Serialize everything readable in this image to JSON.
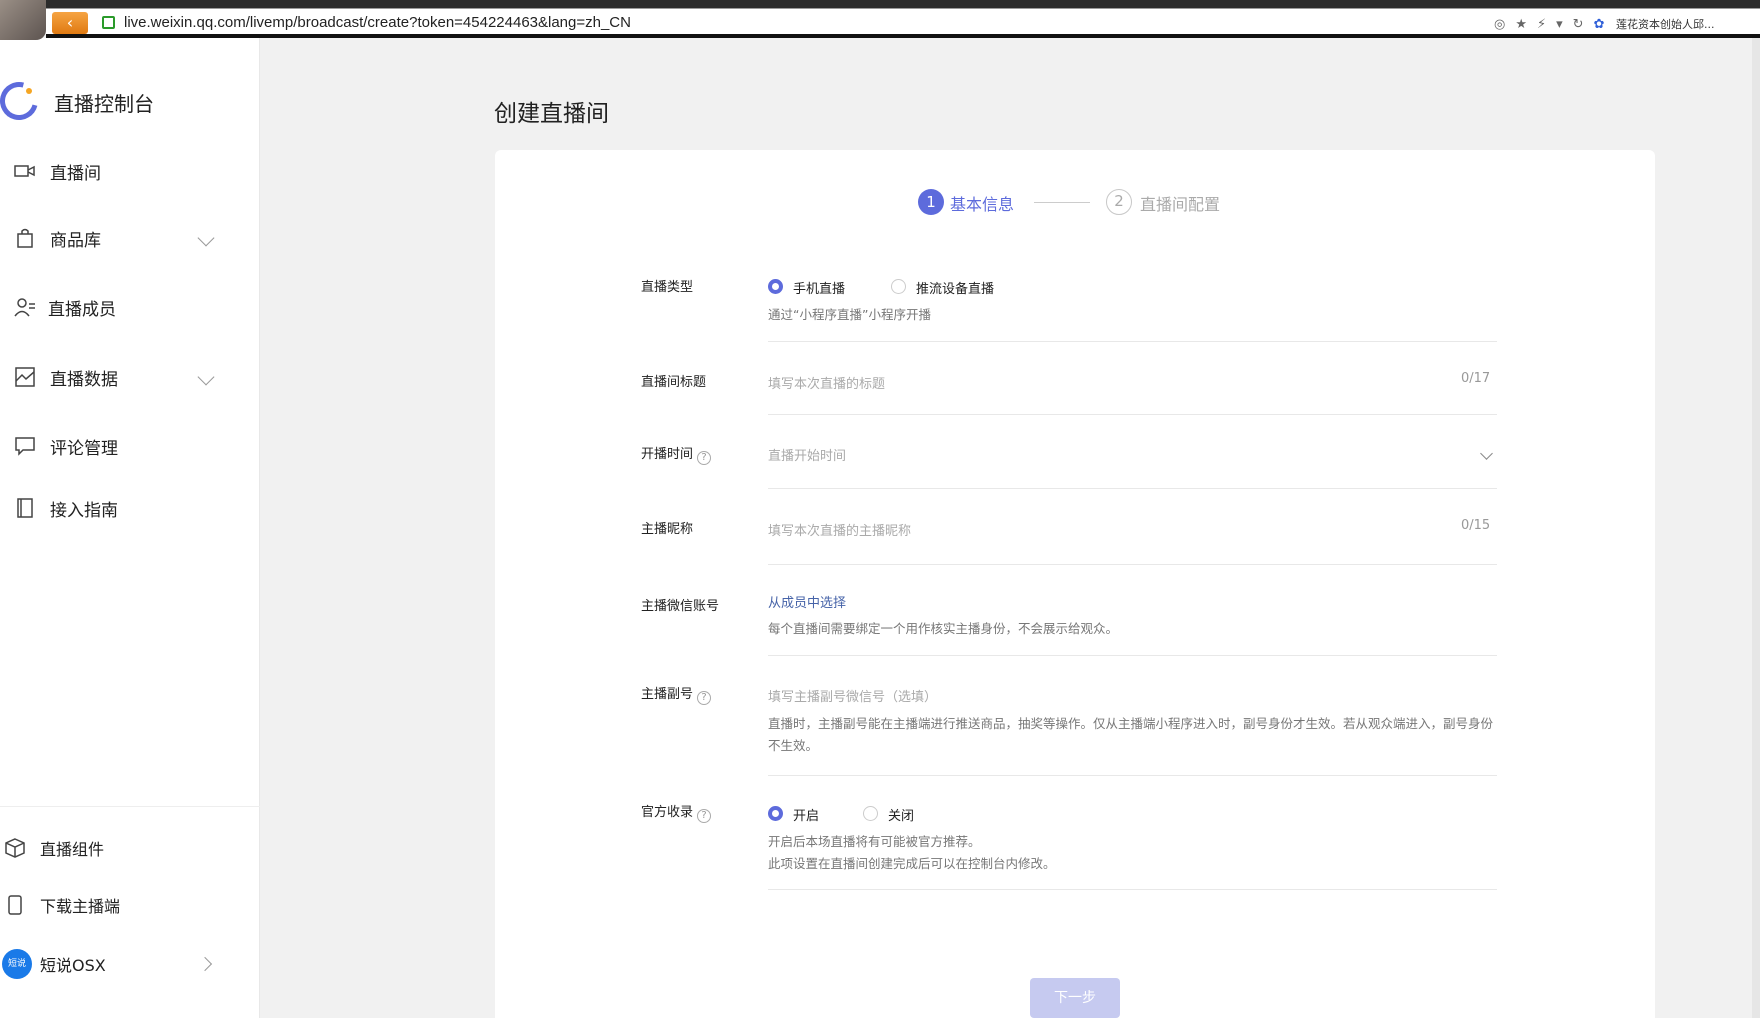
{
  "browser": {
    "url": "live.weixin.qq.com/livemp/broadcast/create?token=454224463&lang=zh_CN",
    "search_engine_label": "莲花资本创始人邱...",
    "back_glyph": "‹"
  },
  "sidebar": {
    "title": "直播控制台",
    "nav": [
      {
        "label": "直播间",
        "icon": "video-camera-icon"
      },
      {
        "label": "商品库",
        "icon": "shopping-bag-icon"
      },
      {
        "label": "直播成员",
        "icon": "user-list-icon"
      },
      {
        "label": "直播数据",
        "icon": "chart-icon"
      },
      {
        "label": "评论管理",
        "icon": "comment-icon"
      },
      {
        "label": "接入指南",
        "icon": "book-icon"
      }
    ],
    "bottom": [
      {
        "label": "直播组件",
        "icon": "cube-icon"
      },
      {
        "label": "下载主播端",
        "icon": "phone-icon"
      }
    ],
    "account": {
      "label": "短说OSX",
      "avatar_text": "短说"
    }
  },
  "main": {
    "title": "创建直播间",
    "steps": [
      {
        "num": "1",
        "label": "基本信息"
      },
      {
        "num": "2",
        "label": "直播间配置"
      }
    ],
    "form": {
      "type_label": "直播类型",
      "type_options": [
        "手机直播",
        "推流设备直播"
      ],
      "type_hint": "通过“小程序直播”小程序开播",
      "title_label": "直播间标题",
      "title_placeholder": "填写本次直播的标题",
      "title_counter": "0/17",
      "time_label": "开播时间",
      "time_placeholder": "直播开始时间",
      "nickname_label": "主播昵称",
      "nickname_placeholder": "填写本次直播的主播昵称",
      "nickname_counter": "0/15",
      "wechat_label": "主播微信账号",
      "wechat_link": "从成员中选择",
      "wechat_hint": "每个直播间需要绑定一个用作核实主播身份，不会展示给观众。",
      "sub_label": "主播副号",
      "sub_placeholder": "填写主播副号微信号（选填）",
      "sub_hint": "直播时，主播副号能在主播端进行推送商品，抽奖等操作。仅从主播端小程序进入时，副号身份才生效。若从观众端进入，副号身份不生效。",
      "collect_label": "官方收录",
      "collect_options": [
        "开启",
        "关闭"
      ],
      "collect_hint_1": "开启后本场直播将有可能被官方推荐。",
      "collect_hint_2": "此项设置在直播间创建完成后可以在控制台内修改。"
    },
    "next_button": "下一步"
  },
  "colors": {
    "accent": "#5d6bdc",
    "link": "#4663a8"
  }
}
